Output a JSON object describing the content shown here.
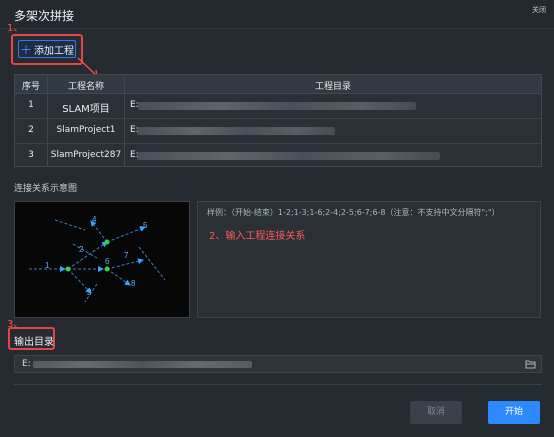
{
  "window": {
    "title": "多架次拼接",
    "close_label": "关闭"
  },
  "annotations": {
    "step1": "1、",
    "step2_hint": "2、输入工程连接关系",
    "step3": "3、"
  },
  "toolbar": {
    "add_label": "添加工程",
    "add_icon": "plus-icon"
  },
  "table": {
    "headers": [
      "序号",
      "工程名称",
      "工程目录"
    ],
    "rows": [
      {
        "index": "1",
        "name": "SLAM项目",
        "path": "E:"
      },
      {
        "index": "2",
        "name": "SlamProject1",
        "path": "E:"
      },
      {
        "index": "3",
        "name": "SlamProject287",
        "path": "E:"
      }
    ]
  },
  "connection": {
    "section_label": "连接关系示意图",
    "placeholder": "样例：（开始-结束）1-2;1-3;1-6;2-4;2-5;6-7;6-8（注意：不支持中文分隔符\";\"）",
    "diagram_labels": [
      "1",
      "2",
      "3",
      "4",
      "5",
      "6",
      "7",
      "8"
    ]
  },
  "output": {
    "label": "输出目录",
    "value": "E:"
  },
  "actions": {
    "cancel": "取消",
    "start": "开始"
  },
  "colors": {
    "primary": "#2d89ff",
    "annotation": "#ff4b4b",
    "background": "#262b32"
  }
}
